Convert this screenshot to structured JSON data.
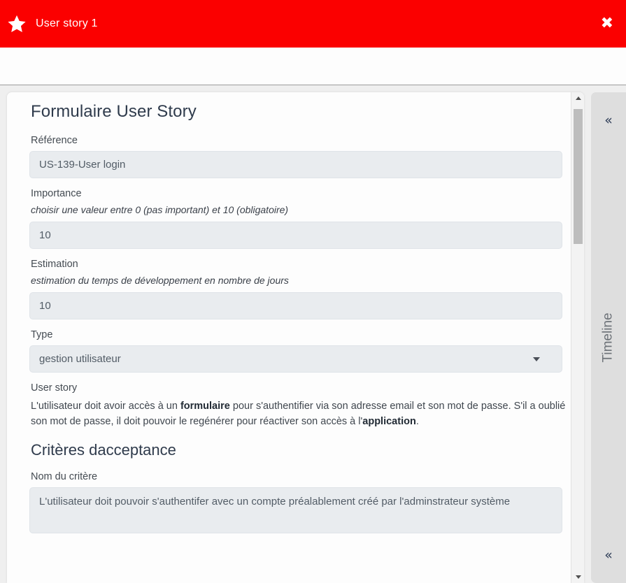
{
  "titlebar": {
    "icon": "star-icon",
    "title": "User story 1",
    "close_label": "✖"
  },
  "form": {
    "title": "Formulaire User Story",
    "fields": [
      {
        "label": "Référence",
        "hint": "",
        "value": "US-139-User login",
        "type": "text"
      },
      {
        "label": "Importance",
        "hint": "choisir une valeur entre 0 (pas important) et 10 (obligatoire)",
        "value": "10",
        "type": "text"
      },
      {
        "label": "Estimation",
        "hint": "estimation du temps de développement en nombre de jours",
        "value": "10",
        "type": "text"
      },
      {
        "label": "Type",
        "hint": "",
        "value": "gestion utilisateur",
        "type": "select"
      }
    ],
    "user_story": {
      "label": "User story",
      "text_part_1": "L'utilisateur doit avoir accès à un ",
      "bold_1": "formulaire",
      "text_part_2": " pour s'authentifier via son adresse email et son mot de passe. S'il a oublié son mot de passe, il doit pouvoir le regénérer pour réactiver son accès à l'",
      "bold_2": "application",
      "text_part_3": "."
    },
    "criteria": {
      "section_title": "Critères dacceptance",
      "name_label": "Nom du critère",
      "name_value": "L'utilisateur doit pouvoir s'authentifer avec un compte préalablement créé par l'adminstrateur système"
    }
  },
  "scrollbar": {
    "up_arrow": "scroll-up-arrow",
    "down_arrow": "scroll-down-arrow"
  },
  "timeline_rail": {
    "label": "Timeline",
    "collapse_top": "«",
    "collapse_bottom": "«"
  },
  "colors": {
    "header_red": "#fb0000",
    "input_bg": "#e9ecef",
    "rail_bg": "#dedede",
    "text_dark": "#2f3b4c"
  }
}
